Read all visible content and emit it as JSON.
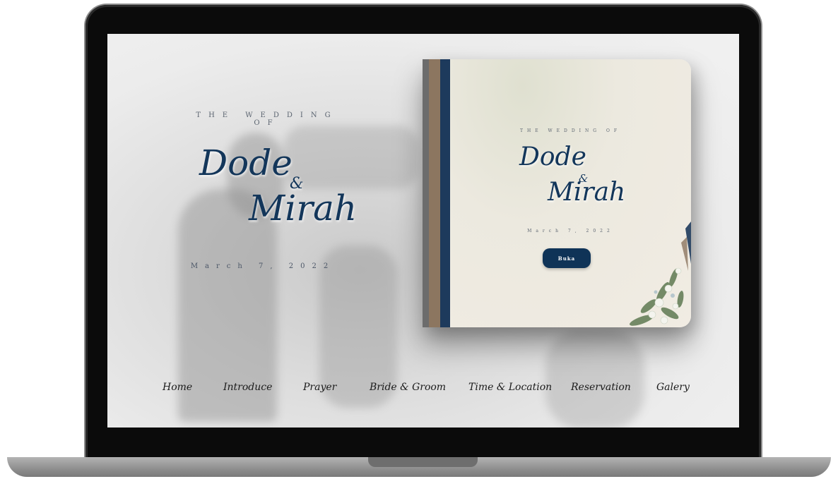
{
  "hero": {
    "kicker": "THE WEDDING OF",
    "name1": "Dode",
    "amp": "&",
    "name2": "Mirah",
    "date": "March 7, 2022"
  },
  "card": {
    "kicker": "THE WEDDING OF",
    "name1": "Dode",
    "amp": "&",
    "name2": "Mirah",
    "date": "March 7, 2022",
    "open_label": "Buka"
  },
  "nav": {
    "items": [
      {
        "label": "Home"
      },
      {
        "label": "Introduce"
      },
      {
        "label": "Prayer"
      },
      {
        "label": "Bride & Groom"
      },
      {
        "label": "Time & Location"
      },
      {
        "label": "Reservation"
      },
      {
        "label": "Galery"
      }
    ]
  },
  "colors": {
    "navy": "#13365a",
    "button": "#0f3357",
    "stripe_gray": "#6c6c6c",
    "stripe_brown": "#8c7660",
    "stripe_navy": "#1d3a5c"
  }
}
